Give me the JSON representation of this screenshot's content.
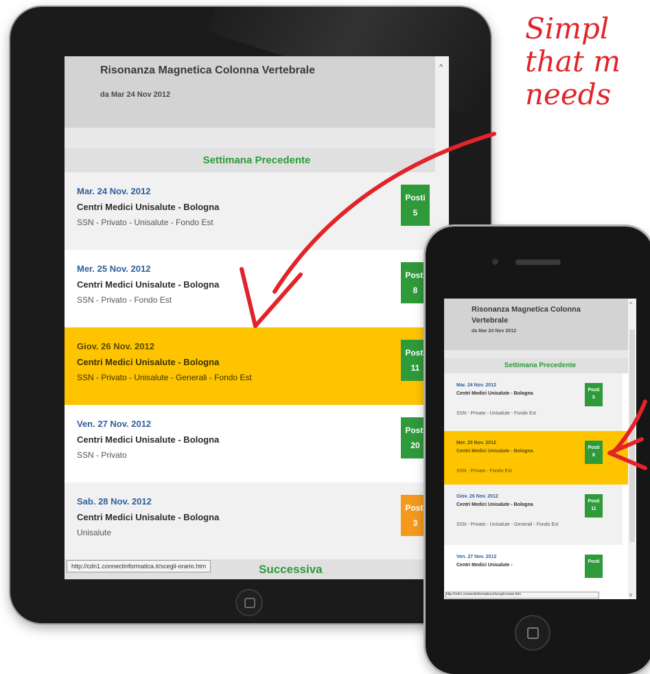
{
  "annotation": {
    "lines": [
      "Simpl",
      "that m",
      "needs"
    ],
    "color": "#e2242a"
  },
  "colors": {
    "week_green": "#2e9a3a",
    "badge_green": "#2e9a3a",
    "badge_orange": "#f39a1c",
    "highlight": "#ffc400",
    "header_gray": "#d3d3d3",
    "date_blue": "#2f5f9c"
  },
  "tablet": {
    "header": {
      "title": "Risonanza Magnetica Colonna Vertebrale",
      "date_range": "da Mar 24 Nov 2012"
    },
    "prev_week_label": "Settimana Precedente",
    "next_week_label": "Successiva",
    "status_url": "http://cdn1.connectinformatica.it/scegli-orario.htm",
    "slots": [
      {
        "date": "Mar. 24 Nov. 2012",
        "center": "Centri Medici Unisalute - Bologna",
        "conventions": "SSN - Privato - Unisalute - Fondo Est",
        "badge_label": "Posti",
        "available": "5",
        "highlighted": false,
        "badge_color": "green"
      },
      {
        "date": "Mer. 25 Nov. 2012",
        "center": "Centri Medici Unisalute - Bologna",
        "conventions": "SSN - Privato - Fondo Est",
        "badge_label": "Posti",
        "available": "8",
        "highlighted": false,
        "badge_color": "green"
      },
      {
        "date": "Giov. 26 Nov. 2012",
        "center": "Centri Medici Unisalute - Bologna",
        "conventions": "SSN - Privato - Unisalute - Generali - Fondo Est",
        "badge_label": "Posti",
        "available": "11",
        "highlighted": true,
        "badge_color": "green"
      },
      {
        "date": "Ven. 27 Nov. 2012",
        "center": "Centri Medici Unisalute - Bologna",
        "conventions": "SSN - Privato",
        "badge_label": "Posti",
        "available": "20",
        "highlighted": false,
        "badge_color": "green"
      },
      {
        "date": "Sab. 28 Nov. 2012",
        "center": "Centri Medici Unisalute - Bologna",
        "conventions": "Unisalute",
        "badge_label": "Posti",
        "available": "3",
        "highlighted": false,
        "badge_color": "orange"
      }
    ]
  },
  "phone": {
    "header": {
      "title": "Risonanza Magnetica Colonna Vertebrale",
      "date_range": "da Mar 24 Nov 2012"
    },
    "prev_week_label": "Settimana Precedente",
    "status_url": "http://cdn1.connectinformatica.it/scegli-orario.htm",
    "slots": [
      {
        "date": "Mar. 24 Nov. 2012",
        "center": "Centri Medici Unisalute - Bologna",
        "conventions": "SSN - Privato - Unisalute - Fondo Est",
        "badge_label": "Posti",
        "available": "5",
        "highlighted": false
      },
      {
        "date": "Mer. 25 Nov. 2012",
        "center": "Centri Medici Unisalute - Bologna",
        "conventions": "SSN - Privato - Fondo Est",
        "badge_label": "Posti",
        "available": "8",
        "highlighted": true
      },
      {
        "date": "Giov. 26 Nov. 2012",
        "center": "Centri Medici Unisalute - Bologna",
        "conventions": "SSN - Privato - Unisalute - Generali - Fondo Est",
        "badge_label": "Posti",
        "available": "11",
        "highlighted": false
      },
      {
        "date": "Ven. 27 Nov. 2012",
        "center": "Centri Medici Unisalute -",
        "conventions": "",
        "badge_label": "Posti",
        "available": "",
        "highlighted": false
      }
    ]
  },
  "icons": [
    "home-button-icon",
    "scroll-up-icon",
    "scroll-down-icon",
    "speaker-grille-icon",
    "camera-icon"
  ]
}
